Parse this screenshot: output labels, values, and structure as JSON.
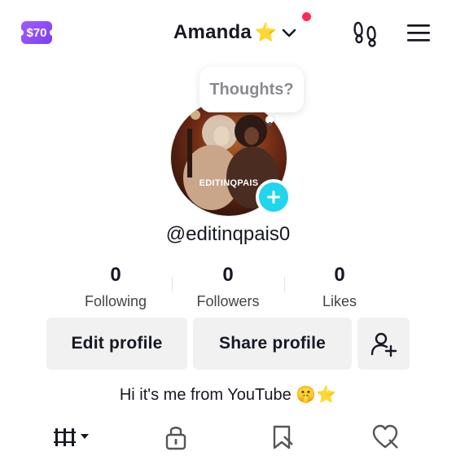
{
  "header": {
    "coin_badge": "$70",
    "account_name": "Amanda",
    "name_emoji": "⭐",
    "notification_color": "#fe2c55",
    "footprint_icon": "footprints-icon",
    "menu_icon": "hamburger-menu-icon"
  },
  "profile": {
    "thought_placeholder": "Thoughts?",
    "avatar_overlay_text": "EDITINQPAIS",
    "username": "@editinqpais0",
    "bio": "Hi it's me from YouTube 🤫⭐"
  },
  "stats": [
    {
      "value": "0",
      "label": "Following"
    },
    {
      "value": "0",
      "label": "Followers"
    },
    {
      "value": "0",
      "label": "Likes"
    }
  ],
  "actions": {
    "edit_label": "Edit profile",
    "share_label": "Share profile",
    "add_friend_icon": "add-friend-icon"
  },
  "tabs": [
    {
      "name": "videos-grid-icon"
    },
    {
      "name": "lock-icon"
    },
    {
      "name": "saved-icon"
    },
    {
      "name": "liked-icon"
    }
  ],
  "colors": {
    "accent": "#20d5ec",
    "badge": "#8b4dff",
    "button_bg": "#f1f1f2"
  }
}
